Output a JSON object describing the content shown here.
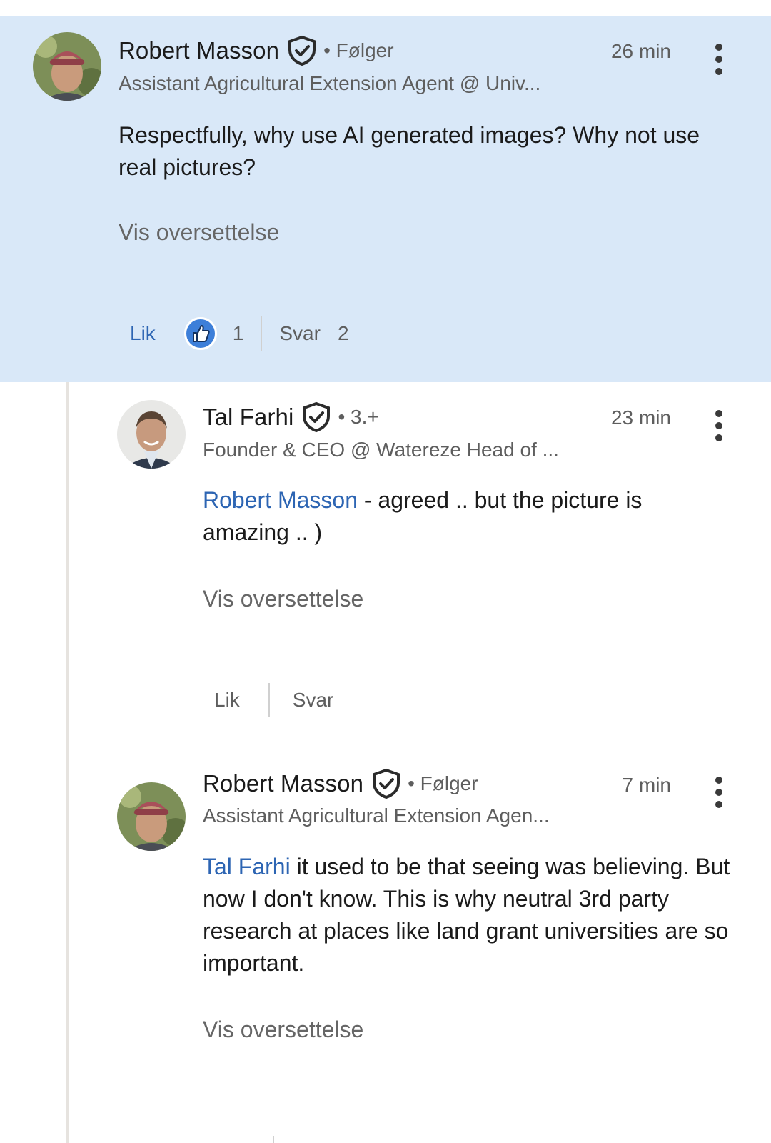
{
  "comments": [
    {
      "author": "Robert Masson",
      "relation": "• Følger",
      "headline": "Assistant Agricultural Extension Agent @ Univ...",
      "time": "26 min",
      "mention": "",
      "text": "Respectfully, why use AI generated images? Why not use real pictures?",
      "translate": "Vis oversettelse",
      "like_label": "Lik",
      "like_count": "1",
      "reply_label": "Svar",
      "reply_count": "2"
    },
    {
      "author": "Tal Farhi",
      "relation": "• 3.+",
      "headline": "Founder & CEO @ Watereze Head of ...",
      "time": "23 min",
      "mention": "Robert Masson",
      "text": " - agreed .. but the picture is amazing .. )",
      "translate": "Vis oversettelse",
      "like_label": "Lik",
      "reply_label": "Svar"
    },
    {
      "author": "Robert Masson",
      "relation": "• Følger",
      "headline": "Assistant Agricultural Extension Agen...",
      "time": "7 min",
      "mention": "Tal Farhi",
      "text": " it used to be that seeing was believing. But now I don't know. This is why neutral 3rd party research at places like land grant universities are so important.",
      "translate": "Vis oversettelse"
    }
  ],
  "colors": {
    "highlight_bg": "#d9e8f8",
    "link": "#2d65b3",
    "thread_line": "#e6e3df"
  },
  "icons": [
    "verified-shield-icon",
    "more-vertical-icon",
    "thumbs-up-icon"
  ]
}
